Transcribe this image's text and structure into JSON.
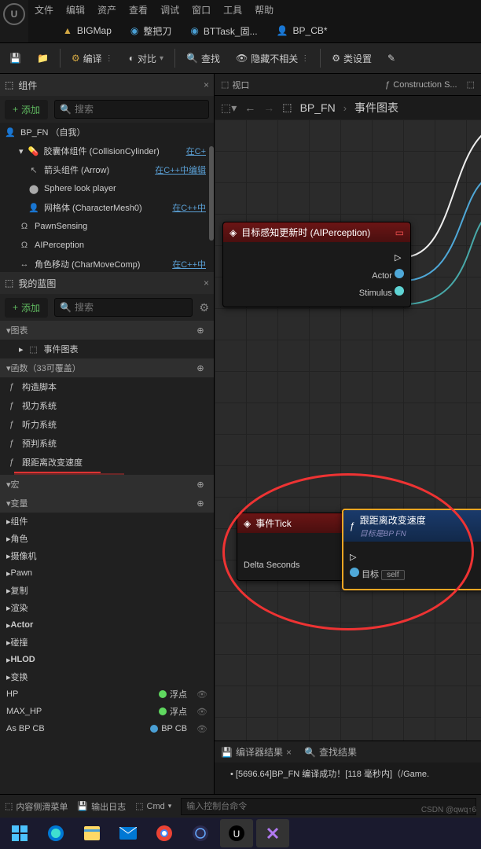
{
  "menubar": [
    "文件",
    "编辑",
    "资产",
    "查看",
    "调试",
    "窗口",
    "工具",
    "帮助"
  ],
  "tabs": [
    {
      "icon_color": "#d4a843",
      "label": "BIGMap"
    },
    {
      "icon_color": "#4a9fd4",
      "label": "整把刀"
    },
    {
      "icon_color": "#4a9fd4",
      "label": "BTTask_固..."
    },
    {
      "icon_color": "#4a9fd4",
      "label": "BP_CB*"
    }
  ],
  "toolbar": {
    "compile": "编译",
    "diff": "对比",
    "find": "查找",
    "hide_unrelated": "隐藏不相关",
    "class_settings": "类设置"
  },
  "components_panel": {
    "title": "组件",
    "add": "添加",
    "search_placeholder": "搜索",
    "items": [
      {
        "icon": "👤",
        "label": "BP_FN （自我）",
        "indent": 0
      },
      {
        "icon": "💊",
        "label": "胶囊体组件 (CollisionCylinder)",
        "link": "在C+",
        "indent": 1,
        "expand": true
      },
      {
        "icon": "↖",
        "label": "箭头组件 (Arrow)",
        "link": "在C++中编辑",
        "indent": 2
      },
      {
        "icon": "⬤",
        "label": "Sphere look player",
        "indent": 2
      },
      {
        "icon": "👤",
        "label": "网格体 (CharacterMesh0)",
        "link": "在C++中",
        "indent": 2
      },
      {
        "icon": "Ω",
        "label": "PawnSensing",
        "indent": 1
      },
      {
        "icon": "Ω",
        "label": "AIPerception",
        "indent": 1
      },
      {
        "icon": "↔",
        "label": "角色移动 (CharMoveComp)",
        "link": "在C++中",
        "indent": 1
      }
    ]
  },
  "blueprint_panel": {
    "title": "我的蓝图",
    "add": "添加",
    "search_placeholder": "搜索",
    "sections": {
      "graphs": "图表",
      "event_graphs": "事件图表",
      "functions": "函数（33可覆盖）",
      "macros": "宏",
      "variables": "变量"
    },
    "functions": [
      "构造脚本",
      "视力系统",
      "听力系统",
      "预判系统",
      "跟距离改变速度"
    ],
    "var_categories": [
      "组件",
      "角色",
      "摄像机",
      "Pawn",
      "复制",
      "渲染",
      "Actor",
      "碰撞",
      "HLOD",
      "变换"
    ],
    "vars": [
      {
        "name": "HP",
        "type": "浮点",
        "color": "#5fd85f"
      },
      {
        "name": "MAX_HP",
        "type": "浮点",
        "color": "#5fd85f"
      },
      {
        "name": "As BP CB",
        "type": "BP CB",
        "color": "#4a9fd4"
      }
    ]
  },
  "right_panel": {
    "viewport_tab": "视口",
    "construction_tab": "Construction S...",
    "breadcrumb_fn": "BP_FN",
    "breadcrumb_graph": "事件图表"
  },
  "nodes": {
    "perception": {
      "title": "目标感知更新时 (AIPerception)",
      "pin_actor": "Actor",
      "pin_stimulus": "Stimulus"
    },
    "tick": {
      "title": "事件Tick",
      "pin_delta": "Delta Seconds"
    },
    "distance": {
      "title": "跟距离改变速度",
      "subtitle": "目标是BP FN",
      "pin_target": "目标",
      "self_value": "self"
    }
  },
  "compiler": {
    "tab_results": "编译器结果",
    "tab_find": "查找结果",
    "message": "[5696.64]BP_FN 编译成功！[118 毫秒内]（/Game."
  },
  "bottombar": {
    "content_drawer": "内容侧滑菜单",
    "output_log": "输出日志",
    "cmd": "Cmd",
    "cmd_placeholder": "输入控制台命令"
  },
  "watermark": "CSDN @qwq↑6"
}
